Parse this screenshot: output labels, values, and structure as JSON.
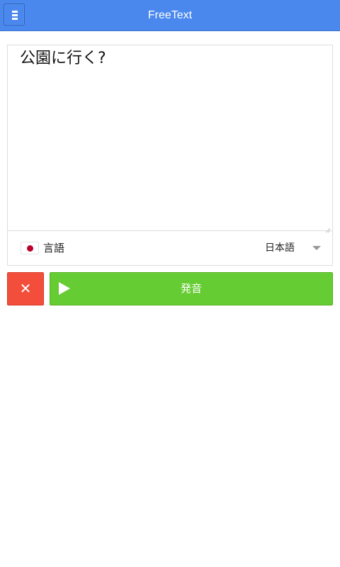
{
  "header": {
    "title": "FreeText",
    "menu_icon": "hamburger-menu-icon",
    "background": "#4a88ee"
  },
  "editor": {
    "text": "公園に行く?"
  },
  "language": {
    "label": "言語",
    "selected": "日本語",
    "flag_icon": "japan-flag-icon"
  },
  "actions": {
    "clear_symbol": "✕",
    "clear_color": "#f24e3b",
    "speak_label": "発音",
    "speak_icon": "play-icon",
    "speak_color": "#66cc33"
  }
}
